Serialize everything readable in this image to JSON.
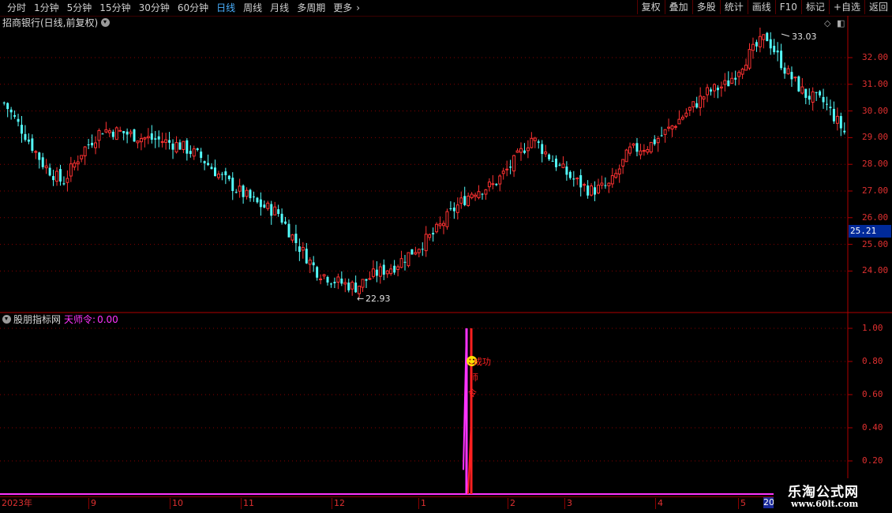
{
  "toolbar": {
    "periods": [
      {
        "label": "分时",
        "active": false
      },
      {
        "label": "1分钟",
        "active": false
      },
      {
        "label": "5分钟",
        "active": false
      },
      {
        "label": "15分钟",
        "active": false
      },
      {
        "label": "30分钟",
        "active": false
      },
      {
        "label": "60分钟",
        "active": false
      },
      {
        "label": "日线",
        "active": true
      },
      {
        "label": "周线",
        "active": false
      },
      {
        "label": "月线",
        "active": false
      },
      {
        "label": "多周期",
        "active": false
      },
      {
        "label": "更多",
        "active": false
      }
    ],
    "more_arrow": "›",
    "buttons": [
      "复权",
      "叠加",
      "多股",
      "统计",
      "画线",
      "F10",
      "标记",
      "+自选",
      "返回"
    ]
  },
  "main_panel": {
    "title": "招商银行(日线,前复权)",
    "icon": "chevron-down-circle-icon",
    "diamond_icon": "◇",
    "toggle_icon": "◧",
    "price_scale": [
      "32.00",
      "31.00",
      "30.00",
      "29.00",
      "28.00",
      "27.00",
      "26.00",
      "25.00",
      "24.00"
    ],
    "current_price": "25.21",
    "high_label": "33.03",
    "low_label": "22.93",
    "colors": {
      "up": "#ff3232",
      "down": "#54ffff",
      "grid": "#8a0000",
      "border": "#b00000"
    }
  },
  "indicator_panel": {
    "title": "股朋指标网",
    "indicator_name": "天师令:",
    "indicator_value": "0.00",
    "scale": [
      "1.00",
      "0.80",
      "0.60",
      "0.40",
      "0.20"
    ],
    "signal_text": "成功",
    "signal_chars": [
      "师",
      "令"
    ],
    "smiley_icon": "☻",
    "colors": {
      "line": "#ff33ff",
      "signal": "#ff2020"
    }
  },
  "date_axis": {
    "labels": [
      "2023年",
      "9",
      "10",
      "11",
      "12",
      "1",
      "2",
      "3",
      "4",
      "5"
    ],
    "edge_label": "20"
  },
  "watermark": {
    "title": "乐淘公式网",
    "url": "www.60lt.com"
  },
  "chart_data": {
    "type": "candlestick",
    "symbol": "招商银行",
    "period": "日线",
    "ylim": [
      22.5,
      33.5
    ],
    "highest": 33.03,
    "lowest": 22.93,
    "last": 25.21,
    "approx_close_path": [
      30.3,
      29.2,
      28.0,
      27.3,
      28.5,
      29.3,
      29.2,
      29.0,
      28.9,
      28.7,
      28.3,
      27.6,
      27.0,
      26.5,
      26.2,
      25.0,
      24.0,
      23.6,
      23.4,
      23.9,
      24.2,
      24.8,
      25.4,
      26.3,
      27.0,
      27.2,
      28.0,
      29.0,
      28.2,
      27.5,
      27.0,
      27.2,
      28.5,
      28.7,
      29.3,
      30.0,
      30.7,
      31.0,
      32.0,
      32.8,
      31.5,
      30.6,
      30.3,
      29.2
    ],
    "indicator": {
      "name": "天师令",
      "ylim": [
        0,
        1.05
      ],
      "spike_positions": [
        0.55,
        0.56
      ],
      "value": 0.0
    }
  }
}
